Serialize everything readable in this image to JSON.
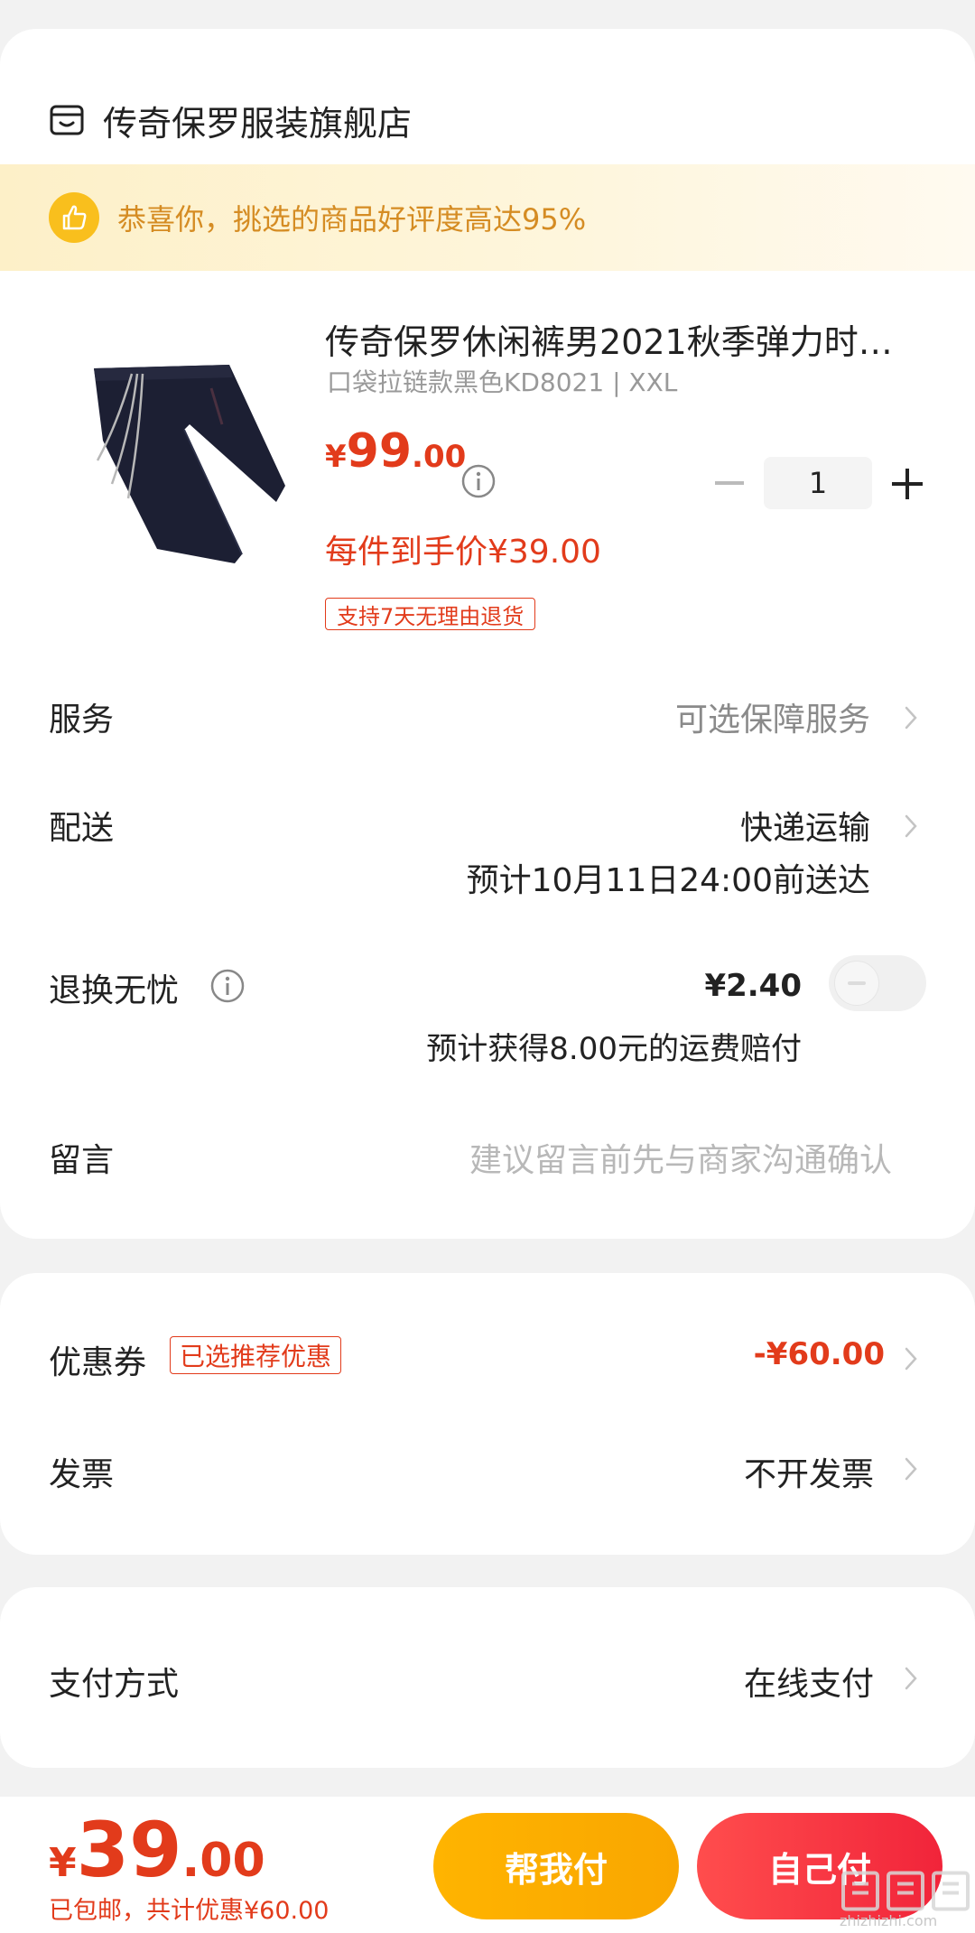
{
  "store": {
    "name": "传奇保罗服装旗舰店",
    "icon": "store-icon"
  },
  "banner": {
    "text": "恭喜你，挑选的商品好评度高达95%",
    "icon": "thumbs-up-icon"
  },
  "product": {
    "title": "传奇保罗休闲裤男2021秋季弹力时尚...",
    "spec": "口袋拉链款黑色KD8021 | XXL",
    "price_symbol": "¥",
    "price_int": "99",
    "price_dec": ".00",
    "quantity": "1",
    "unit_price": "每件到手价¥39.00",
    "return_tag": "支持7天无理由退货"
  },
  "service": {
    "label": "服务",
    "value": "可选保障服务"
  },
  "delivery": {
    "label": "配送",
    "method": "快递运输",
    "eta": "预计10月11日24:00前送达"
  },
  "return_worry": {
    "label": "退换无忧",
    "price": "¥2.40",
    "note": "预计获得8.00元的运费赔付",
    "enabled": false
  },
  "message": {
    "label": "留言",
    "placeholder": "建议留言前先与商家沟通确认"
  },
  "coupon": {
    "label": "优惠券",
    "tag": "已选推荐优惠",
    "value": "-¥60.00"
  },
  "invoice": {
    "label": "发票",
    "value": "不开发票"
  },
  "payment": {
    "label": "支付方式",
    "value": "在线支付"
  },
  "footer": {
    "total_symbol": "¥",
    "total_int": "39",
    "total_dec": ".00",
    "summary": "已包邮，共计优惠¥60.00",
    "help_pay": "帮我付",
    "self_pay": "自己付",
    "watermark": "zhizhizhi.com"
  },
  "colors": {
    "accent_red": "#e23b1b",
    "banner_text": "#d58c23",
    "help_button": "#ffb400",
    "self_button": "#f1243a"
  }
}
